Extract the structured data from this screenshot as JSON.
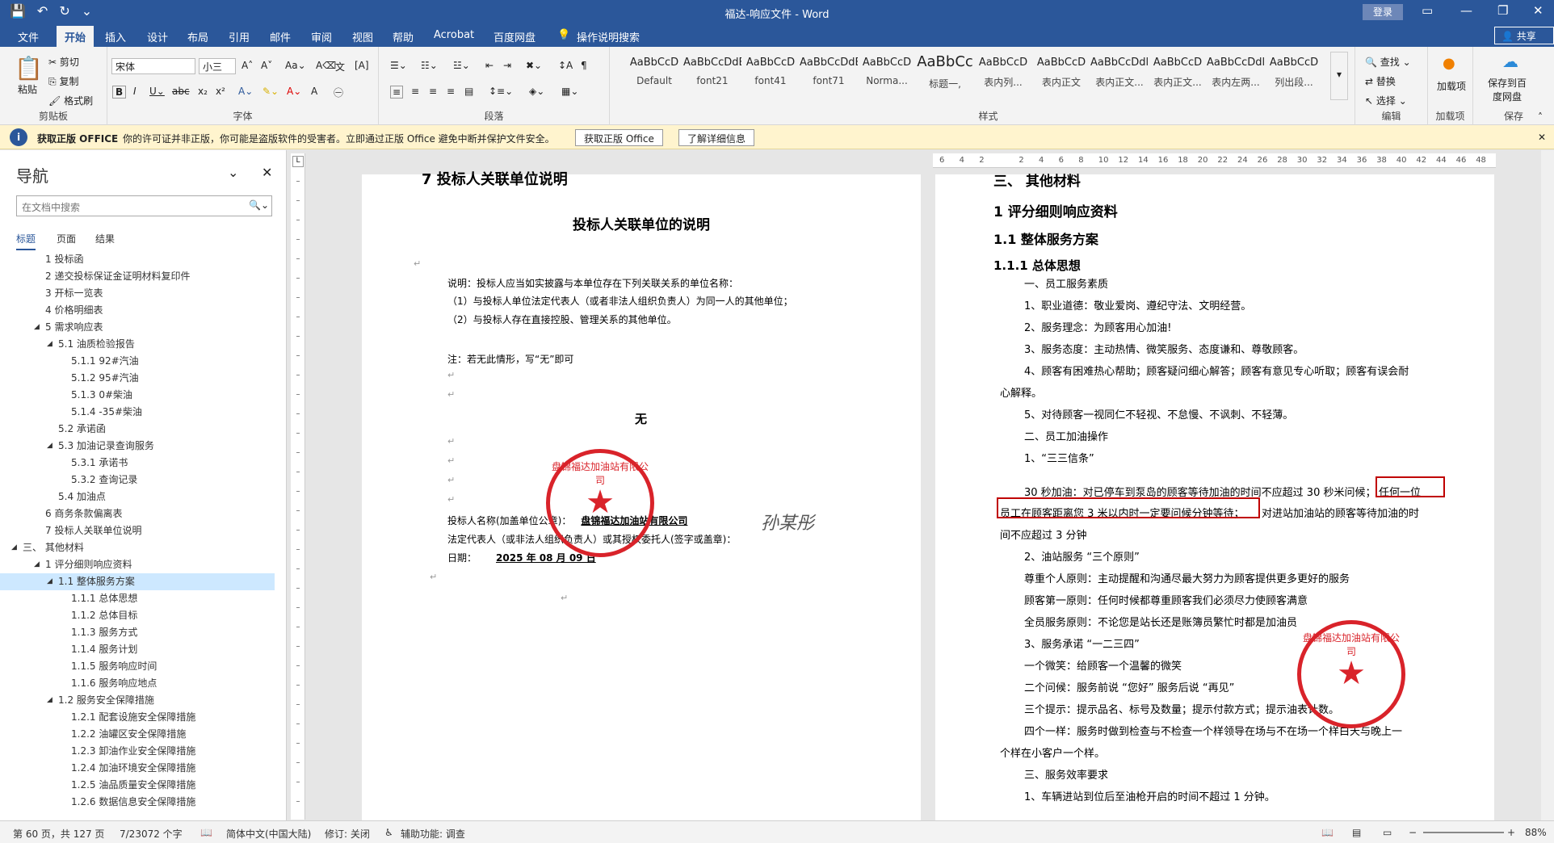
{
  "window": {
    "title": "福达-响应文件 - Word",
    "login": "登录"
  },
  "tabs": [
    {
      "label": "文件"
    },
    {
      "label": "开始"
    },
    {
      "label": "插入"
    },
    {
      "label": "设计"
    },
    {
      "label": "布局"
    },
    {
      "label": "引用"
    },
    {
      "label": "邮件"
    },
    {
      "label": "审阅"
    },
    {
      "label": "视图"
    },
    {
      "label": "帮助"
    },
    {
      "label": "Acrobat"
    },
    {
      "label": "百度网盘"
    },
    {
      "label": "操作说明搜索"
    }
  ],
  "share": "共享",
  "ribbon": {
    "clipboard": {
      "paste": "粘贴",
      "cut": "剪切",
      "copy": "复制",
      "format_painter": "格式刷",
      "label": "剪贴板"
    },
    "font": {
      "family": "宋体",
      "size": "小三",
      "label": "字体"
    },
    "paragraph": {
      "label": "段落"
    },
    "styles": {
      "label": "样式",
      "items": [
        {
          "preview": "AaBbCcD",
          "name": "Default"
        },
        {
          "preview": "AaBbCcDdE",
          "name": "font21"
        },
        {
          "preview": "AaBbCcD",
          "name": "font41"
        },
        {
          "preview": "AaBbCcDdEe",
          "name": "font71"
        },
        {
          "preview": "AaBbCcD",
          "name": "Norma..."
        },
        {
          "preview": "AaBbCc",
          "name": "标题一,"
        },
        {
          "preview": "AaBbCcD",
          "name": "表内列..."
        },
        {
          "preview": "AaBbCcD",
          "name": "表内正文"
        },
        {
          "preview": "AaBbCcDdl",
          "name": "表内正文..."
        },
        {
          "preview": "AaBbCcD",
          "name": "表内正文..."
        },
        {
          "preview": "AaBbCcDdl",
          "name": "表内左两..."
        },
        {
          "preview": "AaBbCcD",
          "name": "列出段..."
        }
      ]
    },
    "editing": {
      "find": "查找",
      "replace": "替换",
      "select": "选择",
      "label": "编辑"
    },
    "addins": {
      "btn": "加载项",
      "label": "加载项"
    },
    "save": {
      "btn": "保存到百度网盘",
      "label": "保存"
    }
  },
  "message_bar": {
    "title": "获取正版 OFFICE",
    "text": "你的许可证并非正版，你可能是盗版软件的受害者。立即通过正版 Office 避免中断并保护文件安全。",
    "btn_get": "获取正版 Office",
    "btn_learn": "了解详细信息"
  },
  "nav": {
    "title": "导航",
    "search_placeholder": "在文档中搜索",
    "tabs": [
      "标题",
      "页面",
      "结果"
    ],
    "items": [
      {
        "text": "1 投标函",
        "level": 2
      },
      {
        "text": "2 递交投标保证金证明材料复印件",
        "level": 2
      },
      {
        "text": "3 开标一览表",
        "level": 2
      },
      {
        "text": "4 价格明细表",
        "level": 2
      },
      {
        "text": "5 需求响应表",
        "level": 2,
        "exp": "◢"
      },
      {
        "text": "5.1 油质检验报告",
        "level": 3,
        "exp": "◢"
      },
      {
        "text": "5.1.1 92#汽油",
        "level": 4
      },
      {
        "text": "5.1.2 95#汽油",
        "level": 4
      },
      {
        "text": "5.1.3 0#柴油",
        "level": 4
      },
      {
        "text": "5.1.4 -35#柴油",
        "level": 4
      },
      {
        "text": "5.2 承诺函",
        "level": 3
      },
      {
        "text": "5.3 加油记录查询服务",
        "level": 3,
        "exp": "◢"
      },
      {
        "text": "5.3.1 承诺书",
        "level": 4
      },
      {
        "text": "5.3.2 查询记录",
        "level": 4
      },
      {
        "text": "5.4 加油点",
        "level": 3
      },
      {
        "text": "6 商务条款偏离表",
        "level": 2
      },
      {
        "text": "7 投标人关联单位说明",
        "level": 2
      },
      {
        "text": "三、 其他材料",
        "level": 1,
        "exp": "◢"
      },
      {
        "text": "1 评分细则响应资料",
        "level": 2,
        "exp": "◢"
      },
      {
        "text": "1.1 整体服务方案",
        "level": 3,
        "exp": "◢",
        "sel": true
      },
      {
        "text": "1.1.1 总体思想",
        "level": 4
      },
      {
        "text": "1.1.2 总体目标",
        "level": 4
      },
      {
        "text": "1.1.3 服务方式",
        "level": 4
      },
      {
        "text": "1.1.4 服务计划",
        "level": 4
      },
      {
        "text": "1.1.5 服务响应时间",
        "level": 4
      },
      {
        "text": "1.1.6 服务响应地点",
        "level": 4
      },
      {
        "text": "1.2 服务安全保障措施",
        "level": 3,
        "exp": "◢"
      },
      {
        "text": "1.2.1 配套设施安全保障措施",
        "level": 4
      },
      {
        "text": "1.2.2 油罐区安全保障措施",
        "level": 4
      },
      {
        "text": "1.2.3 卸油作业安全保障措施",
        "level": 4
      },
      {
        "text": "1.2.4 加油环境安全保障措施",
        "level": 4
      },
      {
        "text": "1.2.5 油品质量安全保障措施",
        "level": 4
      },
      {
        "text": "1.2.6 数据信息安全保障措施",
        "level": 4
      }
    ]
  },
  "left_page": {
    "heading_cut": "7 投标人关联单位说明",
    "title": "投标人关联单位的说明",
    "l1": "说明：投标人应当如实披露与本单位存在下列关联关系的单位名称：",
    "l2": "（1）与投标人单位法定代表人（或者非法人组织负责人）为同一人的其他单位；",
    "l3": "（2）与投标人存在直接控股、管理关系的其他单位。",
    "l4": "注：若无此情形，写“无”即可",
    "none": "无",
    "sig1": "投标人名称(加盖单位公章)：",
    "sig1_val": "盘锦福达加油站有限公司",
    "sig2": "法定代表人（或非法人组织负责人）或其授权委托人(签字或盖章)：",
    "sig3": "日期：",
    "sig3_val": "2025 年 08 月 09 日",
    "signature": "孙某彤"
  },
  "right_page": {
    "h0": "三、 其他材料",
    "h1": "1 评分细则响应资料",
    "h2": "1.1 整体服务方案",
    "h3": "1.1.1 总体思想",
    "p1": "一、员工服务素质",
    "p2": "1、职业道德：敬业爱岗、遵纪守法、文明经营。",
    "p3": "2、服务理念：为顾客用心加油!",
    "p4": "3、服务态度：主动热情、微笑服务、态度谦和、尊敬顾客。",
    "p5": "4、顾客有困难热心帮助；顾客疑问细心解答；顾客有意见专心听取；顾客有误会耐",
    "p5b": "心解释。",
    "p6": "5、对待顾客一视同仁不轻视、不怠慢、不讽刺、不轻薄。",
    "p7": "二、员工加油操作",
    "p8": "1、“三三信条”",
    "p9a": "30 秒加油：对已停车到泵岛的顾客等待加油的时间不应超过 30 秒米问候；",
    "p9b": "任何一位",
    "p10a": "员工在顾客距离您 3 米以内时一定要问候分钟等待；",
    "p10b": "对进站加油站的顾客等待加油的时",
    "p11": "间不应超过 3 分钟",
    "p12": "2、油站服务 “三个原则”",
    "p13": "尊重个人原则：主动提醒和沟通尽最大努力为顾客提供更多更好的服务",
    "p14": "顾客第一原则：任何时候都尊重顾客我们必须尽力使顾客满意",
    "p15": "全员服务原则：不论您是站长还是账簿员繁忙时都是加油员",
    "p16": "3、服务承诺 “一二三四”",
    "p17": "一个微笑：给顾客一个温馨的微笑",
    "p18": "二个问候：服务前说 “您好” 服务后说 “再见”",
    "p19": "三个提示：提示品名、标号及数量；提示付款方式；提示油表计数。",
    "p20": "四个一样：服务时做到检查与不检查一个样领导在场与不在场一个样白天与晚上一",
    "p20b": "个样在小客户一个样。",
    "p21": "三、服务效率要求",
    "p22": "1、车辆进站到位后至油枪开启的时间不超过 1 分钟。"
  },
  "seal_text": "盘锦福达加油站有限公司",
  "status": {
    "page": "第 60 页，共 127 页",
    "words": "7/23072 个字",
    "lang": "简体中文(中国大陆)",
    "track": "修订: 关闭",
    "access": "辅助功能: 调查",
    "zoom": "88%"
  },
  "colors": {
    "brand": "#2b579a",
    "seal": "#d9232a",
    "highlight_box": "#c00000"
  }
}
